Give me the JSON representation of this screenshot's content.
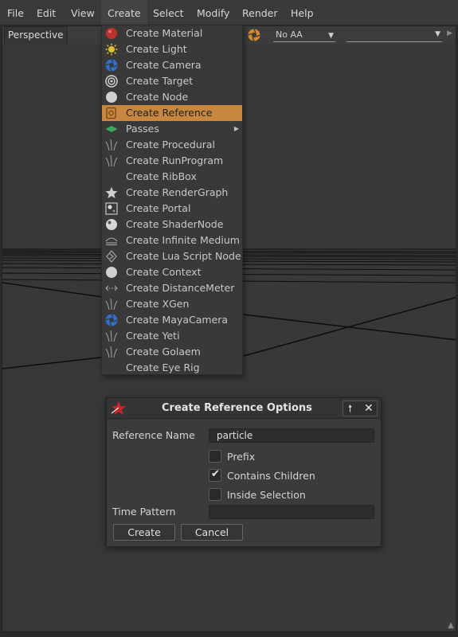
{
  "menubar": {
    "items": [
      "File",
      "Edit",
      "View",
      "Create",
      "Select",
      "Modify",
      "Render",
      "Help"
    ]
  },
  "viewport": {
    "tab_label": "Perspective",
    "aa_select_value": "No AA",
    "second_select_value": ""
  },
  "create_menu": {
    "items": [
      {
        "label": "Create Material",
        "icon": "material-sphere-icon"
      },
      {
        "label": "Create Light",
        "icon": "light-bulb-icon"
      },
      {
        "label": "Create Camera",
        "icon": "camera-aperture-icon"
      },
      {
        "label": "Create Target",
        "icon": "target-icon"
      },
      {
        "label": "Create Node",
        "icon": "node-circle-icon"
      },
      {
        "label": "Create Reference",
        "icon": "reference-icon",
        "highlighted": true
      },
      {
        "label": "Passes",
        "icon": "passes-diamond-icon",
        "submenu": true
      },
      {
        "label": "Create Procedural",
        "icon": "procedural-grass-icon"
      },
      {
        "label": "Create RunProgram",
        "icon": "runprogram-grass-icon"
      },
      {
        "label": "Create RibBox",
        "icon": ""
      },
      {
        "label": "Create RenderGraph",
        "icon": "rendergraph-star-icon"
      },
      {
        "label": "Create Portal",
        "icon": "portal-icon"
      },
      {
        "label": "Create ShaderNode",
        "icon": "shadernode-sphere-icon"
      },
      {
        "label": "Create Infinite Medium",
        "icon": "infinite-medium-icon"
      },
      {
        "label": "Create Lua Script Node",
        "icon": "lua-script-icon"
      },
      {
        "label": "Create Context",
        "icon": "context-circle-icon"
      },
      {
        "label": "Create DistanceMeter",
        "icon": "distance-meter-icon"
      },
      {
        "label": "Create XGen",
        "icon": "xgen-grass-icon"
      },
      {
        "label": "Create MayaCamera",
        "icon": "maya-camera-icon"
      },
      {
        "label": "Create Yeti",
        "icon": "yeti-grass-icon"
      },
      {
        "label": "Create Golaem",
        "icon": "golaem-grass-icon"
      },
      {
        "label": "Create Eye Rig",
        "icon": ""
      }
    ]
  },
  "dialog": {
    "title": "Create Reference Options",
    "up_button": "🠕",
    "close_button": "✕",
    "reference_name_label": "Reference Name",
    "reference_name_value": "particle",
    "prefix_label": "Prefix",
    "prefix_checked": false,
    "contains_children_label": "Contains Children",
    "contains_children_checked": true,
    "inside_selection_label": "Inside Selection",
    "inside_selection_checked": false,
    "time_pattern_label": "Time Pattern",
    "time_pattern_value": "",
    "create_button": "Create",
    "cancel_button": "Cancel"
  },
  "colors": {
    "highlight": "#c8873f",
    "menu_bg": "#393939",
    "viewport_bg": "#383838"
  }
}
